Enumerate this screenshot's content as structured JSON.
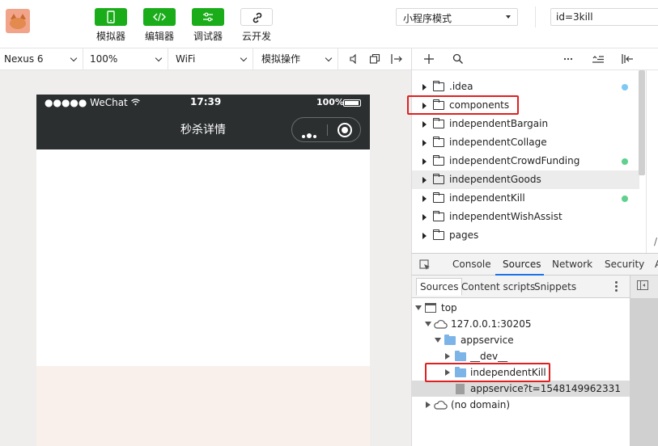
{
  "toolbar": {
    "buttons": [
      {
        "label": "模拟器",
        "icon": "phone-icon"
      },
      {
        "label": "编辑器",
        "icon": "code-icon"
      },
      {
        "label": "调试器",
        "icon": "debug-icon"
      },
      {
        "label": "云开发",
        "icon": "cloud-link-icon"
      }
    ],
    "mode": "小程序模式",
    "param": "id=3kill",
    "accent": "#1aad19"
  },
  "simbar": {
    "device": "Nexus 6",
    "zoom": "100%",
    "network": "WiFi",
    "ops": "模拟操作"
  },
  "phone": {
    "carrier": "●●●●● WeChat",
    "time": "17:39",
    "battery": "100%",
    "title": "秒杀详情"
  },
  "filetree": {
    "items": [
      {
        "name": ".idea",
        "dot": "#7ec8f5"
      },
      {
        "name": "components",
        "dot": ""
      },
      {
        "name": "independentBargain",
        "dot": ""
      },
      {
        "name": "independentCollage",
        "dot": ""
      },
      {
        "name": "independentCrowdFunding",
        "dot": "#5fd08e"
      },
      {
        "name": "independentGoods",
        "dot": ""
      },
      {
        "name": "independentKill",
        "dot": "#5fd08e"
      },
      {
        "name": "independentWishAssist",
        "dot": ""
      },
      {
        "name": "pages",
        "dot": ""
      }
    ],
    "editor_hint": "/i"
  },
  "devtools": {
    "tabs": [
      "Console",
      "Sources",
      "Network",
      "Security",
      "A"
    ],
    "active_tab": "Sources",
    "subtabs": [
      "Sources",
      "Content scripts",
      "Snippets"
    ],
    "tree": {
      "top": "top",
      "host": "127.0.0.1:30205",
      "appservice": "appservice",
      "dev": "__dev__",
      "kill": "independentKill",
      "file": "appservice?t=1548149962331",
      "nodomain": "(no domain)"
    }
  }
}
